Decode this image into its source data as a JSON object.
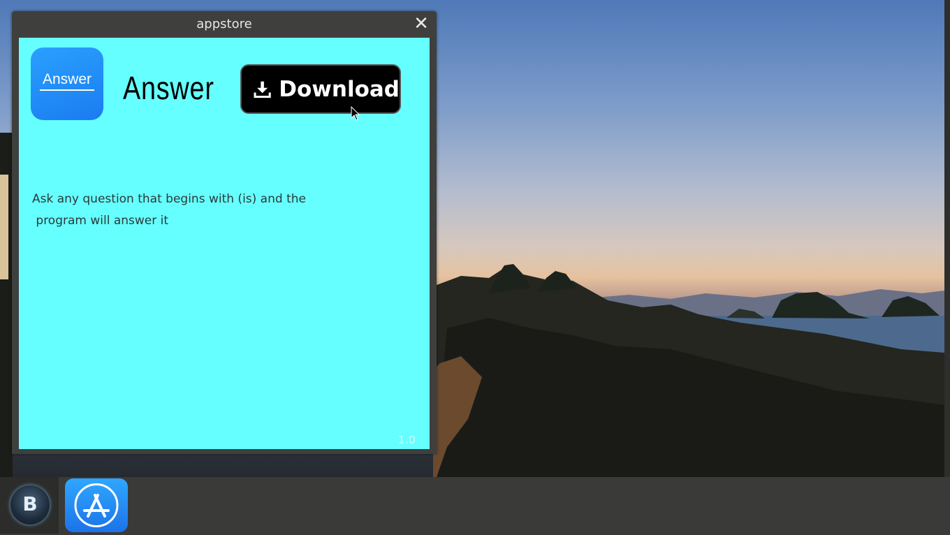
{
  "window": {
    "title": "appstore",
    "close_label": "✕"
  },
  "app": {
    "icon_label": "Answer",
    "name": "Answer",
    "download_label": "Download",
    "description_line1": "Ask any question that begins with (is) and the",
    "description_line2": " program will answer it",
    "version": "1.0",
    "background_color": "#66ffff"
  },
  "taskbar": {
    "start_label": "B",
    "apps": [
      {
        "icon": "app-store-icon"
      }
    ]
  }
}
